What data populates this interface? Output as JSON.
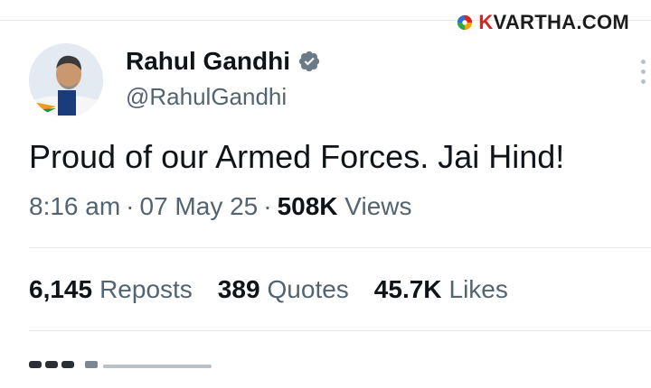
{
  "watermark": {
    "k": "K",
    "rest": "VARTHA.COM"
  },
  "tweet": {
    "author_name": "Rahul Gandhi",
    "handle": "@RahulGandhi",
    "text": "Proud of our Armed Forces. Jai Hind!",
    "time": "8:16 am",
    "date": "07 May 25",
    "views_count": "508K",
    "views_label": "Views",
    "sep": "·"
  },
  "stats": {
    "reposts_count": "6,145",
    "reposts_label": "Reposts",
    "quotes_count": "389",
    "quotes_label": "Quotes",
    "likes_count": "45.7K",
    "likes_label": "Likes"
  },
  "colors": {
    "accent": "#1d9bf0",
    "muted": "#536471",
    "text": "#0f1419"
  },
  "icons": {
    "verified": "verified-badge-icon",
    "more": "more-options-icon"
  }
}
